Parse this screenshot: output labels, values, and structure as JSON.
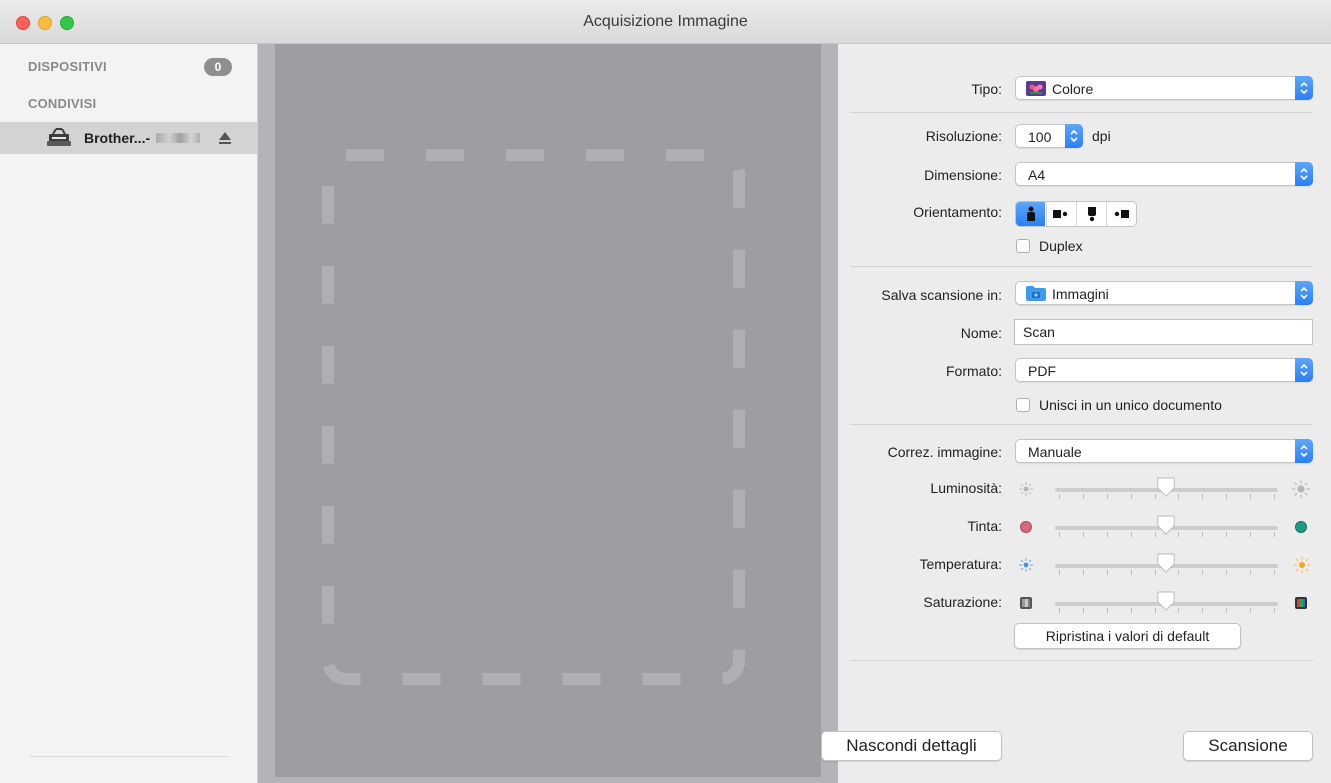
{
  "window": {
    "title": "Acquisizione Immagine"
  },
  "sidebar": {
    "devices_header": "DISPOSITIVI",
    "devices_count": "0",
    "shared_header": "CONDIVISI",
    "device_name": "Brother...-"
  },
  "panel": {
    "tipo": {
      "label": "Tipo:",
      "value": "Colore"
    },
    "risoluzione": {
      "label": "Risoluzione:",
      "value": "100",
      "unit": "dpi"
    },
    "dimensione": {
      "label": "Dimensione:",
      "value": "A4"
    },
    "orientamento": {
      "label": "Orientamento:",
      "selected_index": 0
    },
    "duplex": {
      "label": "Duplex",
      "checked": false
    },
    "salva": {
      "label": "Salva scansione in:",
      "value": "Immagini"
    },
    "nome": {
      "label": "Nome:",
      "value": "Scan"
    },
    "formato": {
      "label": "Formato:",
      "value": "PDF"
    },
    "unisci": {
      "label": "Unisci in un unico documento",
      "checked": false
    },
    "correz": {
      "label": "Correz. immagine:",
      "value": "Manuale"
    },
    "sliders": [
      {
        "key": "luminosita",
        "label": "Luminosità:",
        "value": 0.5,
        "min_icon": "brightness-low-icon",
        "max_icon": "brightness-high-icon"
      },
      {
        "key": "tinta",
        "label": "Tinta:",
        "value": 0.5,
        "min_icon": "tint-magenta-icon",
        "max_icon": "tint-green-icon",
        "min_color": "#d9667f",
        "max_color": "#1f9a80"
      },
      {
        "key": "temperatura",
        "label": "Temperatura:",
        "value": 0.5,
        "min_icon": "temperature-cool-icon",
        "max_icon": "temperature-warm-icon",
        "min_color": "#4a90e2",
        "max_color": "#f5a623"
      },
      {
        "key": "saturazione",
        "label": "Saturazione:",
        "value": 0.5,
        "min_icon": "saturation-low-icon",
        "max_icon": "saturation-high-icon"
      }
    ],
    "reset_button": "Ripristina i valori di default"
  },
  "footer": {
    "hide_details": "Nascondi dettagli",
    "scan": "Scansione"
  },
  "colors": {
    "accent": "#2b7ff2",
    "sidebar_bg": "#f3f3f3",
    "selection_bg": "#d3d3d3",
    "preview_bg": "#b4b4b8",
    "preview_page": "#9c9ea2"
  }
}
